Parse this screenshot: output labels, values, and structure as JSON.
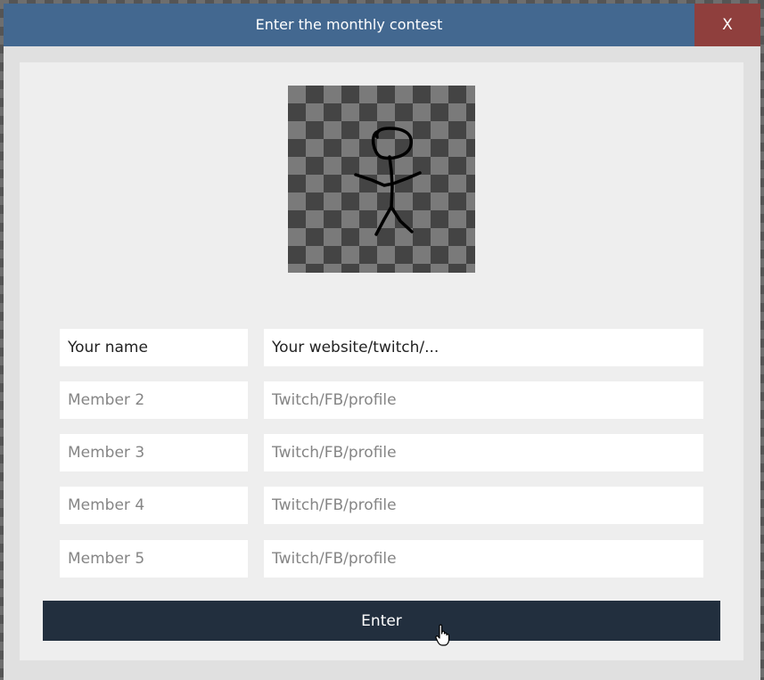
{
  "dialog": {
    "title": "Enter the monthly contest",
    "close_label": "X",
    "submit_label": "Enter"
  },
  "members": [
    {
      "name_value": "Your name",
      "name_placeholder": "",
      "link_value": "Your website/twitch/...",
      "link_placeholder": ""
    },
    {
      "name_value": "",
      "name_placeholder": "Member 2",
      "link_value": "",
      "link_placeholder": "Twitch/FB/profile"
    },
    {
      "name_value": "",
      "name_placeholder": "Member 3",
      "link_value": "",
      "link_placeholder": "Twitch/FB/profile"
    },
    {
      "name_value": "",
      "name_placeholder": "Member 4",
      "link_value": "",
      "link_placeholder": "Twitch/FB/profile"
    },
    {
      "name_value": "",
      "name_placeholder": "Member 5",
      "link_value": "",
      "link_placeholder": "Twitch/FB/profile"
    }
  ],
  "colors": {
    "titlebar": "#436890",
    "close_button": "#8f3f3d",
    "submit_button": "#222f3e"
  },
  "icons": {
    "drawing": "stick-figure-drawing",
    "cursor": "hand-pointer-cursor"
  }
}
